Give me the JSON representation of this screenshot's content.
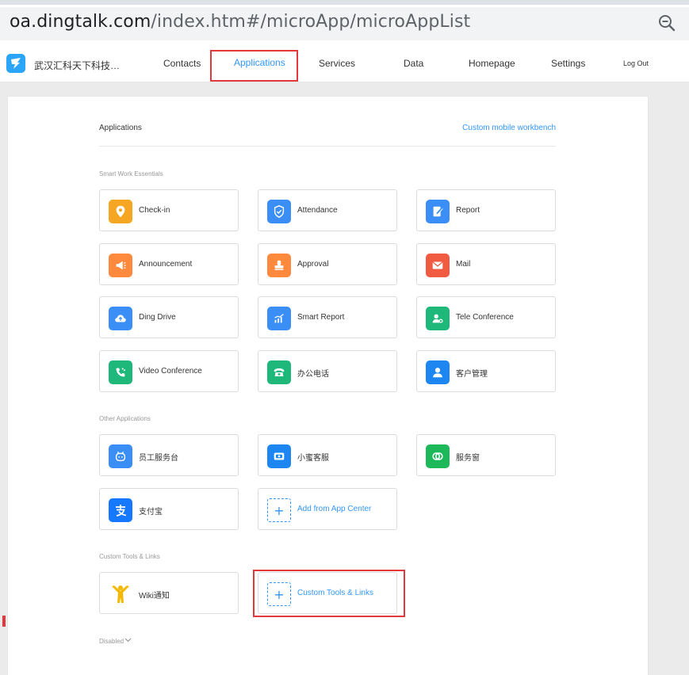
{
  "browser": {
    "url_host": "oa.dingtalk.com",
    "url_path": "/index.htm#/microApp/microAppList",
    "zoom_icon": "zoom-out-icon"
  },
  "appnav": {
    "org_name": "武汉汇科天下科技…",
    "items": [
      "Contacts",
      "Applications",
      "Services",
      "Data",
      "Homepage",
      "Settings"
    ],
    "active": "Applications",
    "logout": "Log Out"
  },
  "page": {
    "title": "Applications",
    "custom_link": "Custom mobile workbench"
  },
  "sections": {
    "essentials": {
      "title": "Smart Work Essentials",
      "apps": [
        {
          "label": "Check-in",
          "icon": "location-pin-icon",
          "color": "#f5a623"
        },
        {
          "label": "Attendance",
          "icon": "shield-check-icon",
          "color": "#3a8ef6"
        },
        {
          "label": "Report",
          "icon": "report-icon",
          "color": "#3a8ef6"
        },
        {
          "label": "Announcement",
          "icon": "megaphone-icon",
          "color": "#ff8a3d"
        },
        {
          "label": "Approval",
          "icon": "stamp-icon",
          "color": "#ff8a3d"
        },
        {
          "label": "Mail",
          "icon": "mail-icon",
          "color": "#f05b41"
        },
        {
          "label": "Ding Drive",
          "icon": "cloud-icon",
          "color": "#3a8ef6"
        },
        {
          "label": "Smart Report",
          "icon": "chart-icon",
          "color": "#3a8ef6"
        },
        {
          "label": "Tele Conference",
          "icon": "conference-icon",
          "color": "#1db87a"
        },
        {
          "label": "Video Conference",
          "icon": "phone-video-icon",
          "color": "#1db87a"
        },
        {
          "label": "办公电话",
          "icon": "telephone-icon",
          "color": "#1db87a"
        },
        {
          "label": "客户管理",
          "icon": "user-icon",
          "color": "#1d86f0"
        }
      ]
    },
    "other": {
      "title": "Other Applications",
      "apps": [
        {
          "label": "员工服务台",
          "icon": "robot-icon",
          "color": "#3a8ef6"
        },
        {
          "label": "小蜜客服",
          "icon": "service-icon",
          "color": "#1d86f0"
        },
        {
          "label": "服务窗",
          "icon": "window-icon",
          "color": "#1db85a"
        },
        {
          "label": "支付宝",
          "icon": "alipay-icon",
          "color": "#1677ff"
        }
      ],
      "add_label": "Add from App Center"
    },
    "custom": {
      "title": "Custom Tools & Links",
      "apps": [
        {
          "label": "Wiki通知",
          "icon": "wiki-figure-icon",
          "color": "#f5b800"
        }
      ],
      "add_label": "Custom Tools & Links"
    }
  },
  "disabled_label": "Disabled"
}
